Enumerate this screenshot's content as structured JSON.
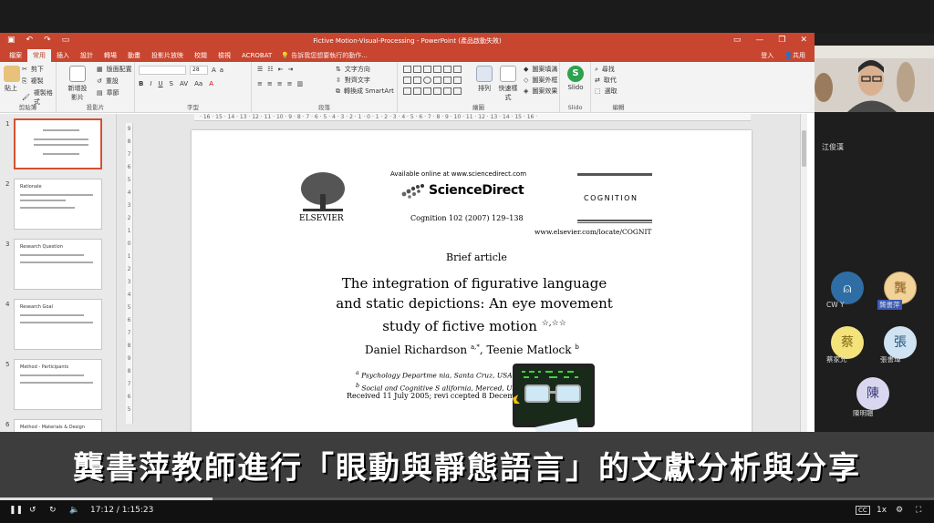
{
  "ppt": {
    "window_title": "Fictive Motion-Visual-Processing - PowerPoint (產品啟動失敗)",
    "tabs": [
      "檔案",
      "常用",
      "插入",
      "設計",
      "轉場",
      "動畫",
      "投影片放映",
      "校閱",
      "檢視",
      "ACROBAT"
    ],
    "active_tab": "常用",
    "search_hint": "告訴我您想要執行的動作...",
    "account": "登入",
    "share": "共用",
    "ribbon": {
      "clipboard": {
        "paste": "貼上",
        "cut": "剪下",
        "copy": "複製",
        "format_painter": "複製格式",
        "label": "剪貼簿"
      },
      "slides": {
        "new_slide": "新增投影片",
        "layout": "版面配置",
        "reset": "重設",
        "section": "章節",
        "label": "投影片"
      },
      "font": {
        "label": "字型",
        "size": "28"
      },
      "paragraph": {
        "text_direction": "文字方向",
        "align_text": "對齊文字",
        "convert_smartart": "轉換成 SmartArt",
        "label": "段落"
      },
      "drawing": {
        "arrange": "排列",
        "quick_styles": "快速樣式",
        "shape_fill": "圖案填滿",
        "shape_outline": "圖案外框",
        "shape_effects": "圖案效果",
        "label": "繪圖"
      },
      "slido": {
        "name": "Slido",
        "label": "Slido"
      },
      "editing": {
        "find": "尋找",
        "replace": "取代",
        "select": "選取",
        "label": "編輯"
      }
    }
  },
  "thumbnails": [
    {
      "num": "1",
      "title": ""
    },
    {
      "num": "2",
      "title": "Rationale"
    },
    {
      "num": "3",
      "title": "Research Question"
    },
    {
      "num": "4",
      "title": "Research Goal"
    },
    {
      "num": "5",
      "title": "Method - Participants"
    },
    {
      "num": "6",
      "title": "Method - Materials & Design"
    }
  ],
  "slide": {
    "available": "Available online at www.sciencedirect.com",
    "sciencedirect": "ScienceDirect",
    "elsevier": "ELSEVIER",
    "journal": "Cognition 102 (2007) 129–138",
    "cognition": "COGNITION",
    "url": "www.elsevier.com/locate/COGNIT",
    "article_type": "Brief article",
    "title_l1": "The integration of figurative language",
    "title_l2": "and static depictions: An eye movement",
    "title_l3": "study of fictive motion",
    "title_mark": "☆,☆☆",
    "authors": "Daniel Richardson",
    "authors_sup1": "a,*",
    "authors2": ", Teenie Matlock",
    "authors_sup2": "b",
    "aff1": "Psychology Departme                        nia, Santa Cruz, USA",
    "aff2": "Social and Cognitive S                         alifornia, Merced, USA",
    "received": "Received 11 July 2005; revi                   ccepted 8 December 2005"
  },
  "participants": {
    "speaker": "江俊漢",
    "people": [
      {
        "name": "CW Y",
        "initial": "",
        "color": "#2f6ea5"
      },
      {
        "name": "龔書萍",
        "initial": "龔",
        "color": "#f1d39a"
      },
      {
        "name": "蔡家允",
        "initial": "蔡",
        "color": "#f4e27b"
      },
      {
        "name": "張書瑋",
        "initial": "張",
        "color": "#cfe3f2"
      },
      {
        "name": "陳明聰",
        "initial": "陳",
        "color": "#d9d7ef"
      }
    ]
  },
  "subtitle": "龔書萍教師進行「眼動與靜態語言」的文獻分析與分享",
  "player": {
    "time": "17:12 / 1:15:23",
    "progress": 0.228,
    "speed": "1x",
    "cc": "CC"
  }
}
